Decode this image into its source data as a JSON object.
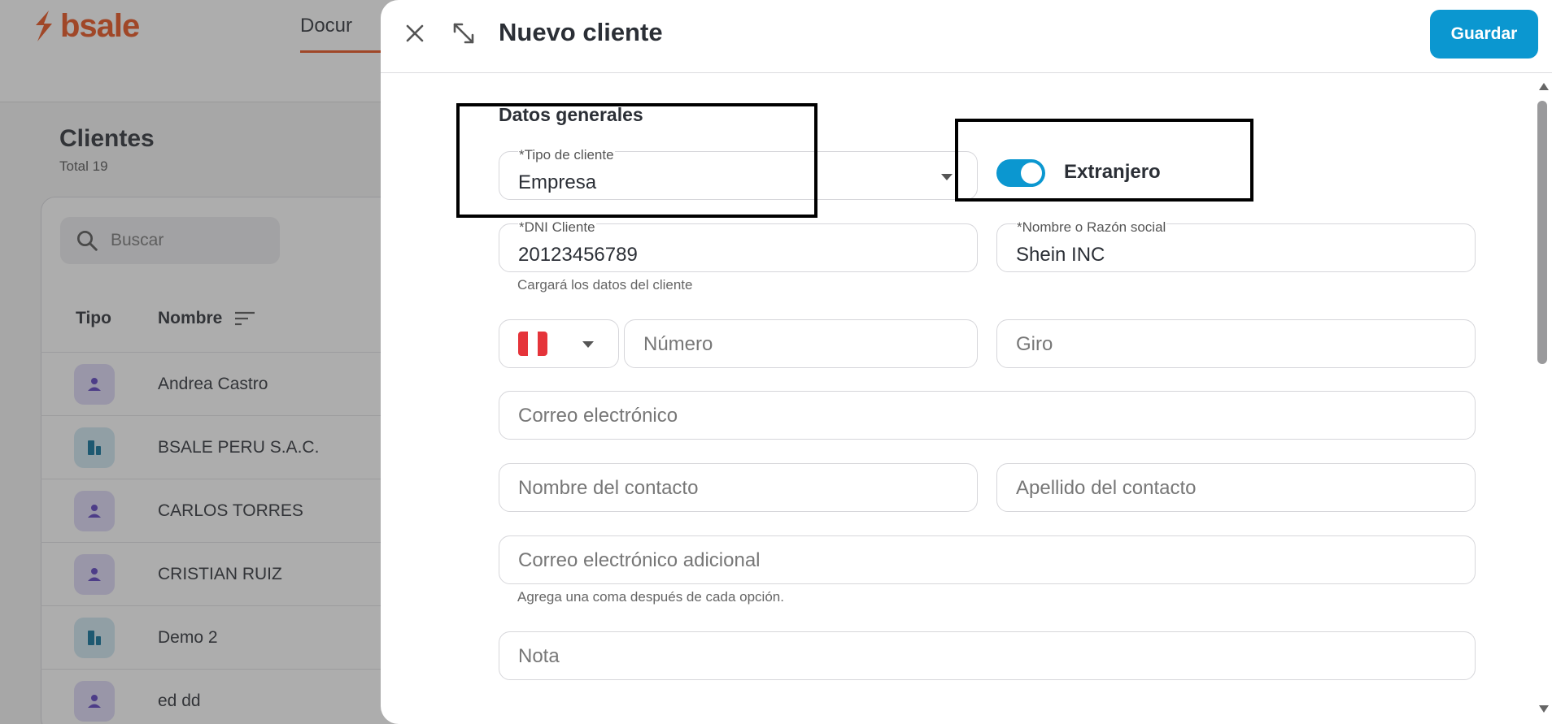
{
  "background": {
    "brand": "bsale",
    "brand_color": "#e8501a",
    "nav_tab": "Docur",
    "page_title": "Clientes",
    "total_label": "Total 19",
    "search_placeholder": "Buscar",
    "columns": [
      "Tipo",
      "Nombre"
    ],
    "rows": [
      {
        "type": "person",
        "name": "Andrea Castro"
      },
      {
        "type": "company",
        "name": "BSALE PERU S.A.C."
      },
      {
        "type": "person",
        "name": "CARLOS TORRES"
      },
      {
        "type": "person",
        "name": "CRISTIAN RUIZ"
      },
      {
        "type": "company",
        "name": "Demo 2"
      },
      {
        "type": "person",
        "name": "ed dd"
      }
    ]
  },
  "panel": {
    "title": "Nuevo cliente",
    "save_label": "Guardar",
    "accent_color": "#0b97d0",
    "section_general": "Datos generales",
    "tipo_cliente": {
      "label": "*Tipo de cliente",
      "value": "Empresa"
    },
    "extranjero": {
      "label": "Extranjero",
      "enabled": true
    },
    "dni": {
      "label": "*DNI Cliente",
      "value": "20123456789",
      "helper": "Cargará los datos del cliente"
    },
    "razon_social": {
      "label": "*Nombre o Razón social",
      "value": "Shein INC"
    },
    "phone": {
      "country_flag": "peru-flag",
      "placeholder": "Número"
    },
    "giro": {
      "placeholder": "Giro"
    },
    "email": {
      "placeholder": "Correo electrónico"
    },
    "contact_first": {
      "placeholder": "Nombre del contacto"
    },
    "contact_last": {
      "placeholder": "Apellido del contacto"
    },
    "email_extra": {
      "placeholder": "Correo electrónico adicional",
      "helper": "Agrega una coma después de cada opción."
    },
    "nota": {
      "placeholder": "Nota"
    }
  }
}
